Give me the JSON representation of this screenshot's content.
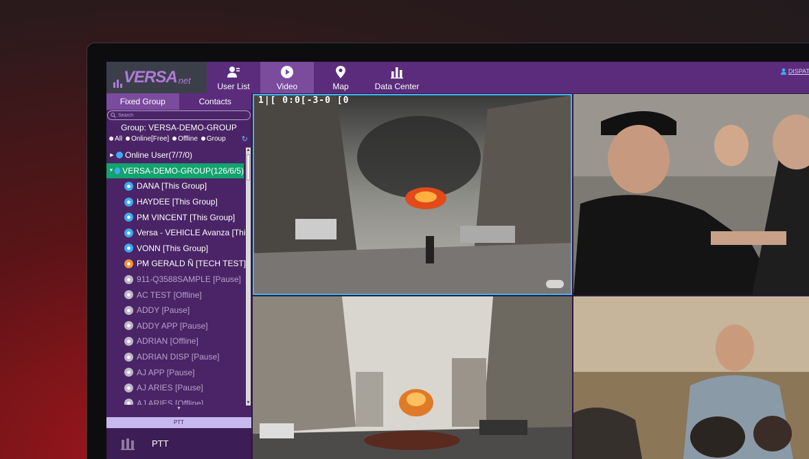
{
  "app": {
    "logo_text": "VERSA",
    "logo_sub": "net",
    "user_link": "DISPATCHE"
  },
  "nav": {
    "tabs": [
      {
        "label": "User List",
        "icon": "user-list-icon"
      },
      {
        "label": "Video",
        "icon": "play-icon"
      },
      {
        "label": "Map",
        "icon": "map-pin-icon"
      },
      {
        "label": "Data Center",
        "icon": "bar-chart-icon"
      }
    ],
    "active": "Video"
  },
  "sidebar": {
    "tabs": [
      "Fixed Group",
      "Contacts"
    ],
    "search_placeholder": "Search",
    "group_label": "Group:  VERSA-DEMO-GROUP",
    "filters": [
      "All",
      "Online[Free]",
      "Offline",
      "Group"
    ],
    "groups": [
      {
        "label": "Online User(7/7/0)",
        "expanded": false
      },
      {
        "label": "VERSA-DEMO-GROUP(126/6/5)",
        "expanded": true
      }
    ],
    "members": [
      {
        "label": "DANA [This Group]",
        "status": "online",
        "icon": "blue"
      },
      {
        "label": "HAYDEE [This Group]",
        "status": "online",
        "icon": "blue"
      },
      {
        "label": "PM VINCENT [This Group]",
        "status": "online",
        "icon": "blue"
      },
      {
        "label": "Versa - VEHICLE Avanza [Thi...",
        "status": "online",
        "icon": "blue"
      },
      {
        "label": "VONN [This Group]",
        "status": "online",
        "icon": "blue"
      },
      {
        "label": "PM GERALD Ñ [TECH TEST]",
        "status": "online",
        "icon": "orange"
      },
      {
        "label": "911-Q3588SAMPLE [Pause]",
        "status": "dim",
        "icon": "gray"
      },
      {
        "label": "AC TEST [Offline]",
        "status": "dim",
        "icon": "gray"
      },
      {
        "label": "ADDY [Pause]",
        "status": "dim",
        "icon": "gray"
      },
      {
        "label": "ADDY APP [Pause]",
        "status": "dim",
        "icon": "gray"
      },
      {
        "label": "ADRIAN [Offline]",
        "status": "dim",
        "icon": "gray"
      },
      {
        "label": "ADRIAN DISP [Pause]",
        "status": "dim",
        "icon": "gray"
      },
      {
        "label": "AJ APP [Pause]",
        "status": "dim",
        "icon": "gray"
      },
      {
        "label": "AJ ARIES [Pause]",
        "status": "dim",
        "icon": "gray"
      },
      {
        "label": "AJ ARIES [Offline]",
        "status": "dim",
        "icon": "gray"
      }
    ],
    "ptt_bar": "PTT",
    "ptt_button": "PTT"
  },
  "video": {
    "osd_text": "1|[ 0:0[-3-0 [0"
  },
  "colors": {
    "topbar": "#5b2c7c",
    "active_tab": "#7b4b9e",
    "selected_group": "#12a36e",
    "accent_blue": "#3fa9f5"
  }
}
